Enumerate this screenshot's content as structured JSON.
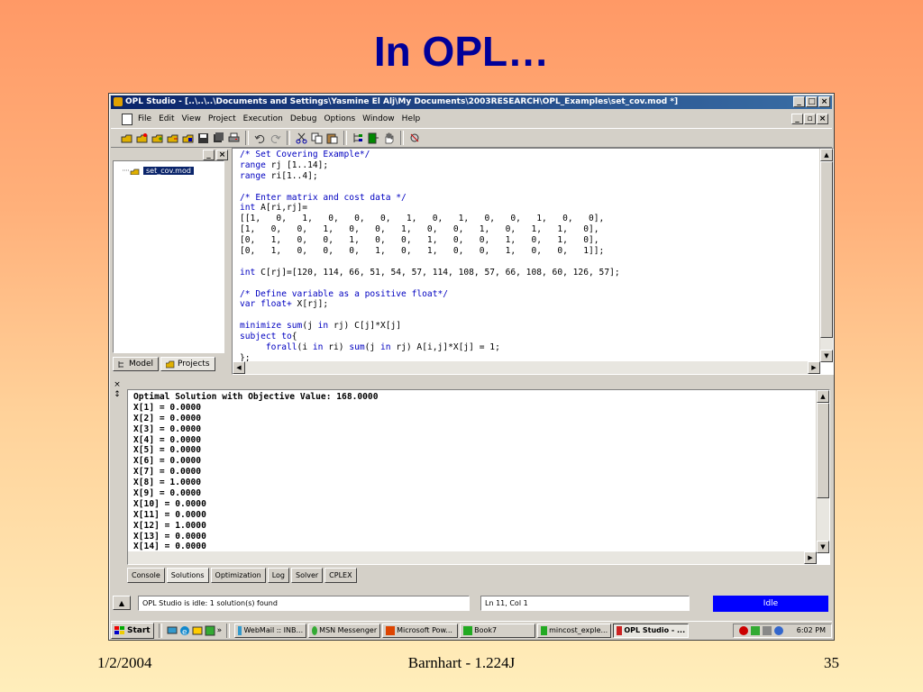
{
  "slide": {
    "title": "In OPL…",
    "footer_date": "1/2/2004",
    "footer_center": "Barnhart - 1.224J",
    "page_number": "35"
  },
  "window": {
    "title": "OPL Studio - [..\\..\\..\\Documents and Settings\\Yasmine El Alj\\My Documents\\2003RESEARCH\\OPL_Examples\\set_cov.mod *]",
    "caption_buttons": [
      "_",
      "□",
      "×"
    ],
    "mdi_buttons": [
      "_",
      "▫",
      "×"
    ]
  },
  "menu": [
    "File",
    "Edit",
    "View",
    "Project",
    "Execution",
    "Debug",
    "Options",
    "Window",
    "Help"
  ],
  "toolbar": {
    "icons": [
      "open-project-icon",
      "new-project-icon",
      "add-file-icon",
      "remove-file-icon",
      "build-icon",
      "save-icon",
      "save-all-icon",
      "print-icon",
      "undo-icon",
      "redo-icon",
      "cut-icon",
      "copy-icon",
      "paste-icon",
      "tree-icon",
      "run-icon",
      "hand-icon",
      "browse-icon"
    ]
  },
  "project_panel": {
    "selected_node": "set_cov.mod",
    "tabs": [
      {
        "label": "Model",
        "icon": "model-tree-icon"
      },
      {
        "label": "Projects",
        "icon": "projects-folder-icon"
      }
    ]
  },
  "editor": {
    "lines": [
      [
        {
          "t": "/* Set Covering Example*/",
          "c": "cmt"
        }
      ],
      [
        {
          "t": "range",
          "c": "kw"
        },
        {
          "t": " rj [1..14];",
          "c": ""
        }
      ],
      [
        {
          "t": "range",
          "c": "kw"
        },
        {
          "t": " ri[1..4];",
          "c": ""
        }
      ],
      [
        {
          "t": "",
          "c": ""
        }
      ],
      [
        {
          "t": "/* Enter matrix and cost data */",
          "c": "cmt"
        }
      ],
      [
        {
          "t": "int",
          "c": "kw"
        },
        {
          "t": " A[ri,rj]=",
          "c": ""
        }
      ],
      [
        {
          "t": "[[1,   0,   1,   0,   0,   0,   1,   0,   1,   0,   0,   1,   0,   0],",
          "c": ""
        }
      ],
      [
        {
          "t": "[1,   0,   0,   1,   0,   0,   1,   0,   0,   1,   0,   1,   1,   0],",
          "c": ""
        }
      ],
      [
        {
          "t": "[0,   1,   0,   0,   1,   0,   0,   1,   0,   0,   1,   0,   1,   0],",
          "c": ""
        }
      ],
      [
        {
          "t": "[0,   1,   0,   0,   0,   1,   0,   1,   0,   0,   1,   0,   0,   1]];",
          "c": ""
        }
      ],
      [
        {
          "t": "",
          "c": ""
        }
      ],
      [
        {
          "t": "int",
          "c": "kw"
        },
        {
          "t": " C[rj]=[120, 114, 66, 51, 54, 57, 114, 108, 57, 66, 108, 60, 126, 57];",
          "c": ""
        }
      ],
      [
        {
          "t": "",
          "c": ""
        }
      ],
      [
        {
          "t": "/* Define variable as a positive float*/",
          "c": "cmt"
        }
      ],
      [
        {
          "t": "var float+",
          "c": "kw"
        },
        {
          "t": " X[rj];",
          "c": ""
        }
      ],
      [
        {
          "t": "",
          "c": ""
        }
      ],
      [
        {
          "t": "minimize",
          "c": "kw"
        },
        {
          "t": " ",
          "c": ""
        },
        {
          "t": "sum",
          "c": "kw"
        },
        {
          "t": "(j ",
          "c": ""
        },
        {
          "t": "in",
          "c": "kw"
        },
        {
          "t": " rj) C[j]*X[j]",
          "c": ""
        }
      ],
      [
        {
          "t": "subject to",
          "c": "kw"
        },
        {
          "t": "{",
          "c": ""
        }
      ],
      [
        {
          "t": "     ",
          "c": ""
        },
        {
          "t": "forall",
          "c": "kw"
        },
        {
          "t": "(i ",
          "c": ""
        },
        {
          "t": "in",
          "c": "kw"
        },
        {
          "t": " ri) ",
          "c": ""
        },
        {
          "t": "sum",
          "c": "kw"
        },
        {
          "t": "(j ",
          "c": ""
        },
        {
          "t": "in",
          "c": "kw"
        },
        {
          "t": " rj) A[i,j]*X[j] = 1;",
          "c": ""
        }
      ],
      [
        {
          "t": "};",
          "c": ""
        }
      ]
    ]
  },
  "output": {
    "lines": [
      "Optimal Solution with Objective Value: 168.0000",
      "X[1] = 0.0000",
      "X[2] = 0.0000",
      "X[3] = 0.0000",
      "X[4] = 0.0000",
      "X[5] = 0.0000",
      "X[6] = 0.0000",
      "X[7] = 0.0000",
      "X[8] = 1.0000",
      "X[9] = 0.0000",
      "X[10] = 0.0000",
      "X[11] = 0.0000",
      "X[12] = 1.0000",
      "X[13] = 0.0000",
      "X[14] = 0.0000"
    ],
    "tabs": [
      "Console",
      "Solutions",
      "Optimization",
      "Log",
      "Solver",
      "CPLEX"
    ],
    "active_tab": "Solutions"
  },
  "status": {
    "message": "OPL Studio is idle: 1 solution(s) found",
    "position": "Ln 11, Col 1",
    "state": "Idle"
  },
  "taskbar": {
    "start_label": "Start",
    "quick_launch_icons": [
      "desktop-icon",
      "ie-icon",
      "outlook-icon",
      "app-icon"
    ],
    "chevron": "»",
    "buttons": [
      {
        "label": "WebMail :: INB...",
        "active": false
      },
      {
        "label": "MSN Messenger",
        "active": false
      },
      {
        "label": "Microsoft Pow...",
        "active": false
      },
      {
        "label": "Book7",
        "active": false
      },
      {
        "label": "mincost_exple...",
        "active": false
      },
      {
        "label": "OPL Studio - ...",
        "active": true
      }
    ],
    "tray_icons": [
      "antivirus-icon",
      "network-icon",
      "volume-icon",
      "messenger-icon"
    ],
    "clock": "6:02 PM"
  },
  "colors": {
    "keyword": "#0000c0",
    "titlebar": "#0a246a",
    "slide_title": "#000099",
    "idle_status": "#0000ff"
  }
}
